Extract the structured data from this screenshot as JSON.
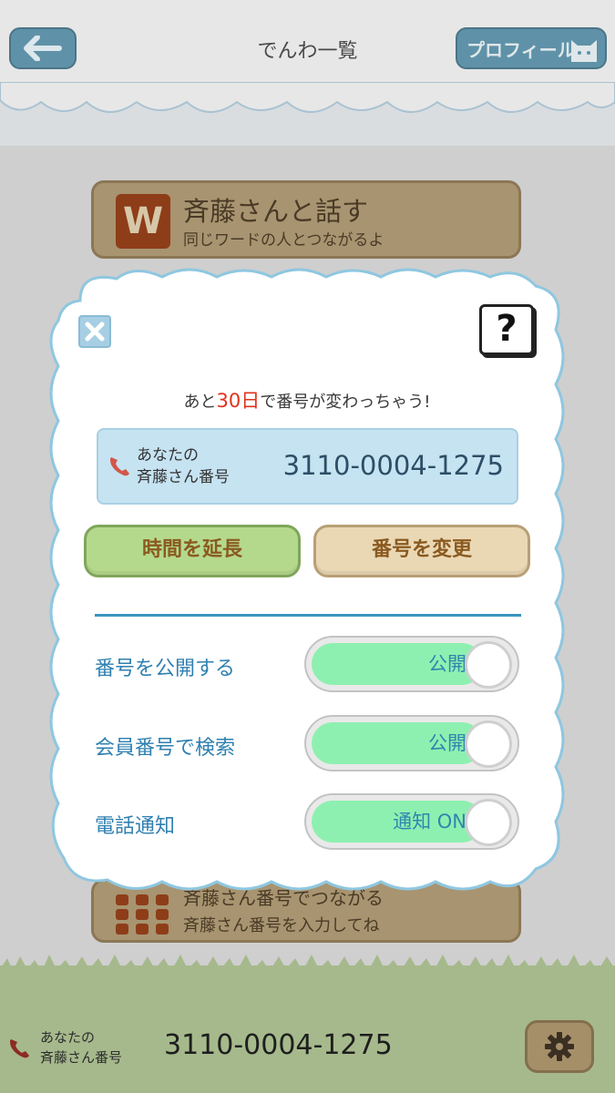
{
  "header": {
    "title": "でんわ一覧",
    "profile_label": "プロフィール"
  },
  "talk_card": {
    "badge": "W",
    "title": "斉藤さんと話す",
    "subtitle": "同じワードの人とつながるよ"
  },
  "dial_card": {
    "title": "斉藤さん番号でつながる",
    "subtitle": "斉藤さん番号を入力してね"
  },
  "modal": {
    "notice_prefix": "あと",
    "notice_days": "30日",
    "notice_suffix": "で番号が変わっちゃう!",
    "number_label_line1": "あなたの",
    "number_label_line2": "斉藤さん番号",
    "number": "3110-0004-1275",
    "extend_button": "時間を延長",
    "change_button": "番号を変更",
    "help_label": "?",
    "settings": [
      {
        "label": "番号を公開する",
        "value": "公開"
      },
      {
        "label": "会員番号で検索",
        "value": "公開"
      },
      {
        "label": "電話通知",
        "value": "通知 ON"
      }
    ]
  },
  "footer": {
    "label_line1": "あなたの",
    "label_line2": "斉藤さん番号",
    "number": "3110-0004-1275"
  },
  "colors": {
    "accent_blue": "#3a94bf",
    "toggle_on": "#8ef0b0",
    "notice_red": "#e0321e"
  }
}
